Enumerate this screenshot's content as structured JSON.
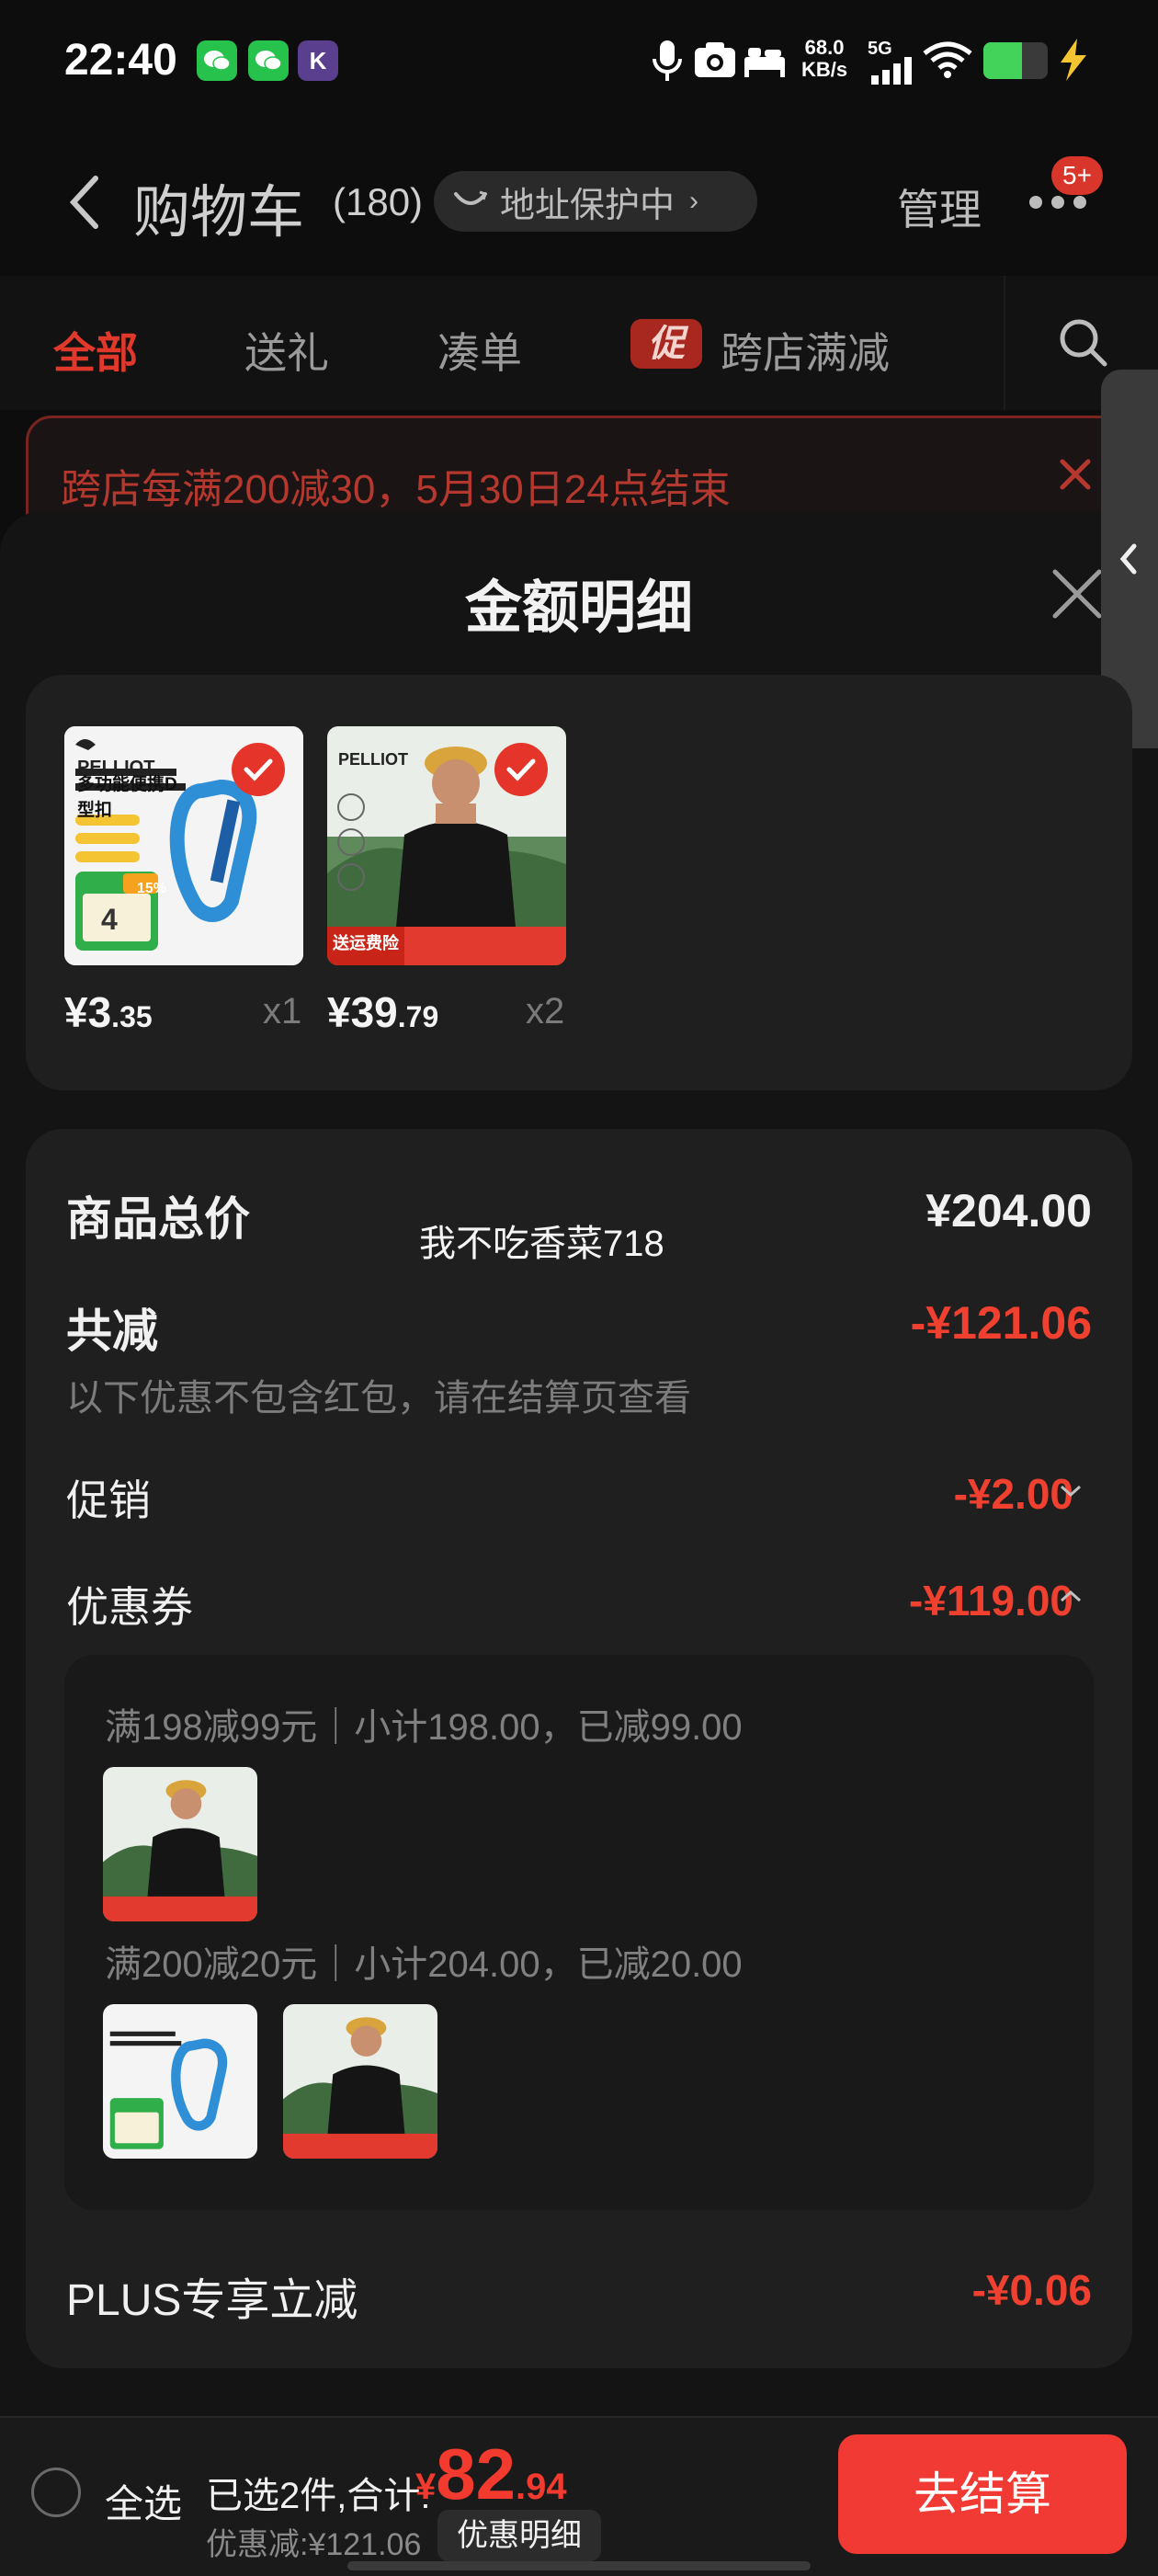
{
  "status_bar": {
    "time": "22:40",
    "net_speed_value": "68.0",
    "net_speed_unit": "KB/s",
    "signal": "5G",
    "battery_level": 0.6,
    "icons": [
      "wechat-icon",
      "wechat-icon",
      "k-app-icon",
      "mic-icon",
      "camera-icon",
      "bed-icon",
      "signal-icon",
      "wifi-icon",
      "battery-icon",
      "charging-icon"
    ]
  },
  "header": {
    "title": "购物车",
    "count": "(180)",
    "address_protect": "地址保护中",
    "manage": "管理",
    "more_badge": "5+"
  },
  "tabs": [
    {
      "label": "全部",
      "active": true
    },
    {
      "label": "送礼",
      "active": false
    },
    {
      "label": "凑单",
      "active": false
    },
    {
      "label": "跨店满减",
      "active": false,
      "icon_text": "促"
    }
  ],
  "banner": {
    "text": "跨店每满200减30，5月30日24点结束"
  },
  "sheet": {
    "title": "金额明细",
    "products": [
      {
        "name": "多功能便携D型扣",
        "price_int": "¥3",
        "price_dec": ".35",
        "qty": "x1",
        "selected": true,
        "brand": "PELLIOT",
        "badge": "15%",
        "badge_num": "4"
      },
      {
        "name": "T恤",
        "price_int": "¥39",
        "price_dec": ".79",
        "qty": "x2",
        "selected": true,
        "brand": "PELLIOT",
        "footer": "送运费险"
      }
    ],
    "watermark": "我不吃香菜718",
    "total_label": "商品总价",
    "total_value": "¥204.00",
    "reduce_label": "共减",
    "reduce_value": "-¥121.06",
    "reduce_note": "以下优惠不包含红包，请在结算页查看",
    "promo_label": "促销",
    "promo_value": "-¥2.00",
    "coupon_label": "优惠券",
    "coupon_value": "-¥119.00",
    "coupon_rules": [
      {
        "text": "满198减99元｜小计198.00，已减99.00"
      },
      {
        "text": "满200减20元｜小计204.00，已减20.00"
      }
    ],
    "plus_label": "PLUS专享立减",
    "plus_value": "-¥0.06"
  },
  "bottom": {
    "select_all": "全选",
    "selected_text": "已选2件,合计:",
    "total_currency": "¥",
    "total_int": "82",
    "total_dec": ".94",
    "discount_text": "优惠减:¥121.06",
    "detail_button": "优惠明细",
    "checkout_button": "去结算"
  },
  "colors": {
    "accent_red": "#f0402f",
    "checkout_red": "#f03a33",
    "background": "#0d0d0d",
    "card": "#1f1f1f"
  }
}
